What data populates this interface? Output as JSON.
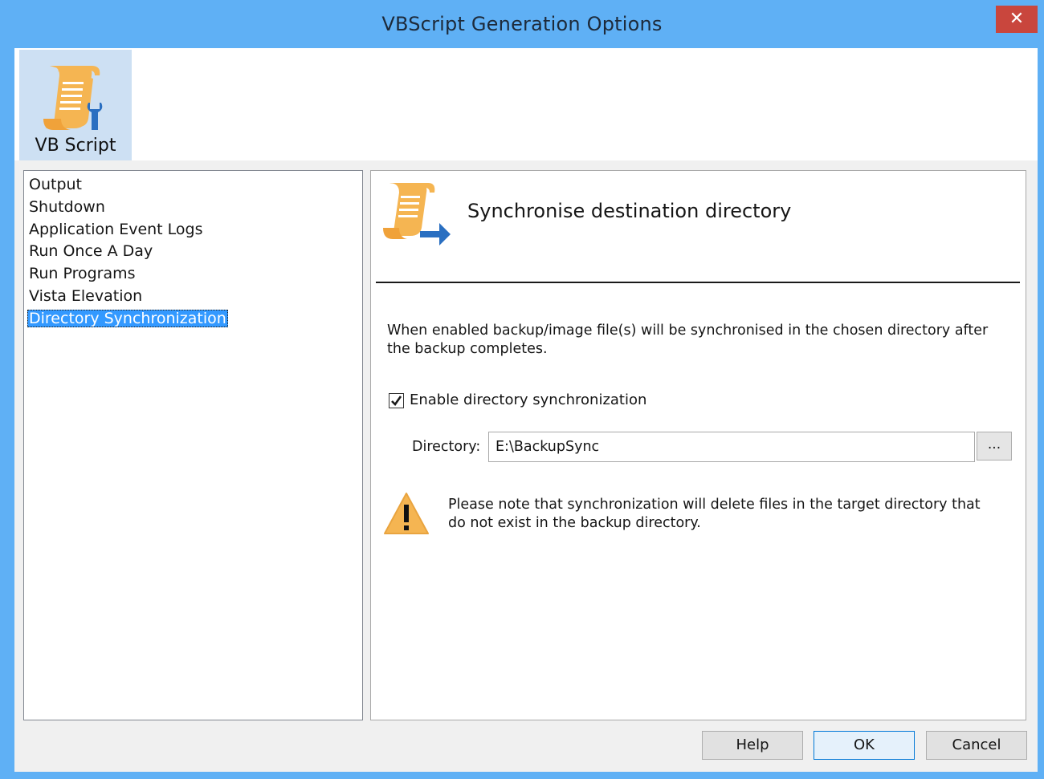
{
  "window": {
    "title": "VBScript Generation Options",
    "close_glyph": "✕"
  },
  "toolbar": {
    "items": [
      {
        "label": "VB Script",
        "icon": "vbscript-scroll-wrench-icon",
        "selected": true
      }
    ]
  },
  "nav": {
    "items": [
      {
        "label": "Output"
      },
      {
        "label": "Shutdown"
      },
      {
        "label": "Application Event Logs"
      },
      {
        "label": "Run Once A Day"
      },
      {
        "label": "Run Programs"
      },
      {
        "label": "Vista Elevation"
      },
      {
        "label": "Directory Synchronization",
        "selected": true
      }
    ]
  },
  "content": {
    "title": "Synchronise destination directory",
    "icon": "scroll-arrow-icon",
    "description": "When enabled backup/image file(s) will be synchronised in the chosen directory after the backup completes.",
    "enable_checkbox": {
      "label": "Enable directory synchronization",
      "checked": true
    },
    "directory": {
      "label": "Directory:",
      "value": "E:\\BackupSync"
    },
    "browse_label": "...",
    "warning_icon": "warning-triangle-icon",
    "warning_text": "Please note that synchronization will delete files in the target directory that do not exist in the backup directory."
  },
  "buttons": {
    "help": "Help",
    "ok": "OK",
    "cancel": "Cancel"
  },
  "colors": {
    "title_bar": "#5fb0f5",
    "close_button": "#c9463d",
    "selection": "#3399ff",
    "icon_orange": "#f5b552",
    "icon_blue": "#2a6fc1"
  }
}
